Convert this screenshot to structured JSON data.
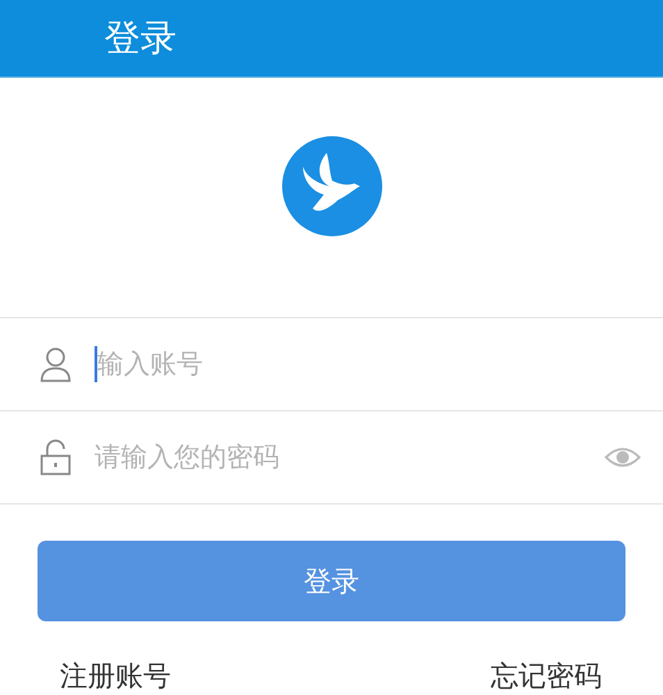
{
  "header": {
    "title": "登录"
  },
  "fields": [
    {
      "kind": "account",
      "placeholder": "输入账号",
      "focused": true
    },
    {
      "kind": "password",
      "placeholder": "请输入您的密码",
      "focused": false
    }
  ],
  "login_button": "登录",
  "links": [
    "注册账号",
    "忘记密码"
  ]
}
